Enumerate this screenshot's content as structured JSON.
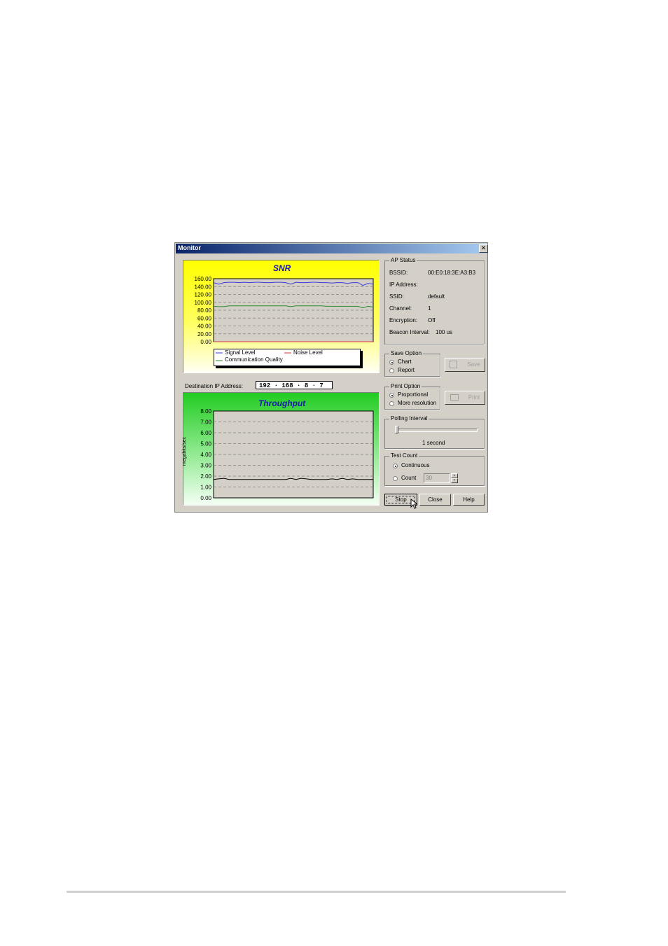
{
  "window": {
    "title": "Monitor",
    "close_glyph": "✕"
  },
  "snr": {
    "title": "SNR",
    "y_ticks": [
      "160.00",
      "140.00",
      "120.00",
      "100.00",
      "80.00",
      "60.00",
      "40.00",
      "20.00",
      "0.00"
    ],
    "legend": {
      "signal": "Signal Level",
      "noise": "Noise Level",
      "quality": "Communication Quality"
    },
    "colors": {
      "bg": "#ffff00",
      "signal": "#3a3ad8",
      "noise": "#d23a3a",
      "quality": "#2a8a2a"
    }
  },
  "destination": {
    "label": "Destination IP Address:",
    "ip_parts": [
      "192",
      "168",
      "8",
      "7"
    ]
  },
  "throughput": {
    "title": "Throughput",
    "ylabel": "megabits/sec",
    "y_ticks": [
      "8.00",
      "7.00",
      "6.00",
      "5.00",
      "4.00",
      "3.00",
      "2.00",
      "1.00",
      "0.00"
    ],
    "colors": {
      "bg": "#22cc22"
    }
  },
  "ap_status": {
    "label": "AP Status",
    "rows": [
      {
        "k": "BSSID:",
        "v": "00:E0:18:3E:A3:B3"
      },
      {
        "k": "IP Address:",
        "v": ""
      },
      {
        "k": "SSID:",
        "v": "default"
      },
      {
        "k": "Channel:",
        "v": "1"
      },
      {
        "k": "Encryption:",
        "v": "Off"
      },
      {
        "k": "Beacon Interval:",
        "v": "100 us"
      }
    ]
  },
  "save_option": {
    "label": "Save Option",
    "chart": "Chart",
    "report": "Report",
    "button": "Save"
  },
  "print_option": {
    "label": "Print Option",
    "proportional": "Proportional",
    "more": "More resolution",
    "button": "Print"
  },
  "polling": {
    "label": "Polling Interval",
    "value_text": "1 second"
  },
  "test_count": {
    "label": "Test Count",
    "continuous": "Continuous",
    "count": "Count",
    "count_value": "30"
  },
  "buttons": {
    "stop": "Stop",
    "close": "Close",
    "help": "Help"
  },
  "chart_data": [
    {
      "type": "line",
      "title": "SNR",
      "ylim": [
        0,
        160
      ],
      "grid": true,
      "legend": "bottom",
      "series": [
        {
          "name": "Signal Level",
          "values": [
            150,
            146,
            150,
            151,
            151,
            150,
            151,
            150,
            151,
            151,
            150,
            150,
            151,
            151,
            150,
            146,
            151,
            150,
            150,
            151,
            151,
            150,
            150,
            149,
            150,
            150,
            148,
            150,
            150,
            143,
            148,
            146
          ]
        },
        {
          "name": "Noise Level",
          "values": [
            0,
            0,
            0,
            0,
            0,
            0,
            0,
            0,
            0,
            0,
            0,
            0,
            0,
            0,
            0,
            0,
            0,
            0,
            0,
            0,
            0,
            0,
            0,
            0,
            0,
            0,
            0,
            0,
            0,
            0,
            0,
            0
          ]
        },
        {
          "name": "Communication Quality",
          "values": [
            90,
            89,
            89,
            91,
            91,
            91,
            91,
            91,
            91,
            91,
            91,
            91,
            91,
            91,
            91,
            89,
            91,
            91,
            91,
            91,
            91,
            91,
            90,
            90,
            90,
            90,
            90,
            90,
            90,
            86,
            90,
            88
          ]
        }
      ]
    },
    {
      "type": "line",
      "title": "Throughput",
      "ylabel": "megabits/sec",
      "ylim": [
        0,
        8
      ],
      "grid": true,
      "series": [
        {
          "values": [
            1.7,
            1.75,
            1.8,
            1.7,
            1.7,
            1.7,
            1.7,
            1.7,
            1.7,
            1.7,
            1.7,
            1.7,
            1.7,
            1.7,
            1.7,
            1.8,
            1.7,
            1.8,
            1.75,
            1.7,
            1.7,
            1.7,
            1.7,
            1.75,
            1.7,
            1.8,
            1.7,
            1.75,
            1.7,
            1.7,
            1.7,
            1.7
          ]
        }
      ]
    }
  ]
}
